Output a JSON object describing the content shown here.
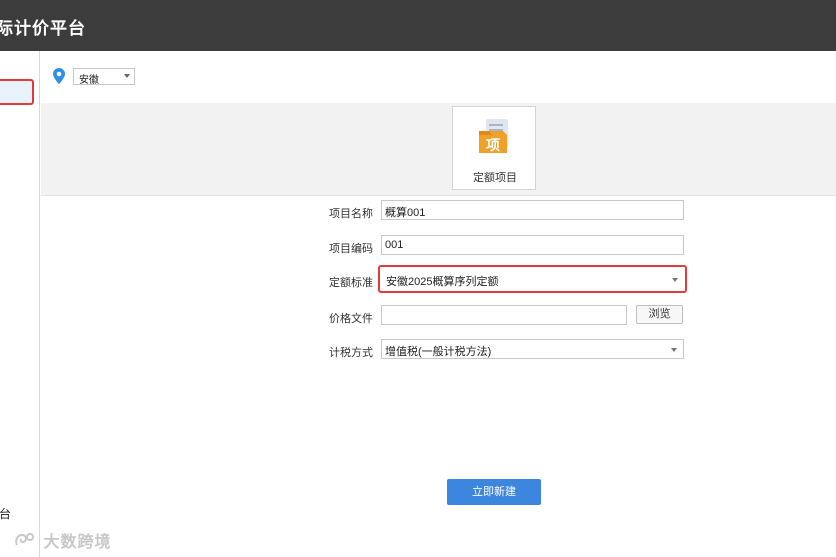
{
  "app": {
    "title": "际计价平台"
  },
  "sidebar": {
    "bottom_label": "台"
  },
  "location": {
    "selected_region": "安徽"
  },
  "project_card": {
    "label": "定额项目",
    "icon_char": "项"
  },
  "form": {
    "project_name": {
      "label": "项目名称",
      "value": "概算001"
    },
    "project_code": {
      "label": "项目编码",
      "value": "001"
    },
    "quota_standard": {
      "label": "定额标准",
      "value": "安徽2025概算序列定额"
    },
    "price_file": {
      "label": "价格文件",
      "value": "",
      "browse_label": "浏览"
    },
    "tax_method": {
      "label": "计税方式",
      "value": "增值税(一般计税方法)"
    }
  },
  "actions": {
    "create_label": "立即新建"
  },
  "watermark": {
    "text": "大数跨境"
  },
  "colors": {
    "titlebar": "#3c3c3c",
    "highlight_border": "#e33b3b",
    "primary_button": "#3d86e0",
    "pin": "#2f8fe6",
    "icon_orange": "#f0a12a"
  }
}
